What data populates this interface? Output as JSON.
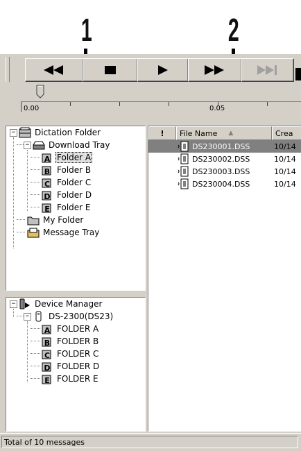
{
  "callouts": [
    {
      "label": "1"
    },
    {
      "label": "2"
    }
  ],
  "toolbar": {
    "buttons": [
      {
        "name": "rewind-button",
        "icon": "rewind-icon",
        "enabled": true
      },
      {
        "name": "stop-button",
        "icon": "stop-icon",
        "enabled": true
      },
      {
        "name": "play-button",
        "icon": "play-icon",
        "enabled": true
      },
      {
        "name": "fast-forward-button",
        "icon": "fast-forward-icon",
        "enabled": true
      },
      {
        "name": "skip-to-end-button",
        "icon": "skip-end-icon",
        "enabled": false
      }
    ]
  },
  "ruler": {
    "labels": [
      "0.00",
      "0.05"
    ]
  },
  "dictation_tree": {
    "root": "Dictation Folder",
    "download_tray": "Download Tray",
    "folders": [
      "Folder A",
      "Folder B",
      "Folder C",
      "Folder D",
      "Folder E"
    ],
    "folder_letters": [
      "A",
      "B",
      "C",
      "D",
      "E"
    ],
    "selected_folder": "Folder A",
    "my_folder": "My Folder",
    "message_tray": "Message Tray"
  },
  "device_tree": {
    "root": "Device Manager",
    "device": "DS-2300(DS23)",
    "folders": [
      "FOLDER A",
      "FOLDER B",
      "FOLDER C",
      "FOLDER D",
      "FOLDER E"
    ],
    "folder_letters": [
      "A",
      "B",
      "C",
      "D",
      "E"
    ]
  },
  "file_list": {
    "columns": [
      "!",
      "File Name",
      "Crea"
    ],
    "sort_indicator": "▲",
    "rows": [
      {
        "file_name": "DS230001.DSS",
        "created": "10/14"
      },
      {
        "file_name": "DS230002.DSS",
        "created": "10/14"
      },
      {
        "file_name": "DS230003.DSS",
        "created": "10/14"
      },
      {
        "file_name": "DS230004.DSS",
        "created": "10/14"
      }
    ],
    "selected_row": 0
  },
  "status": {
    "text": "Total of 10 messages"
  },
  "colors": {
    "face": "#d4d0c8",
    "selection": "#808080",
    "pane_bg": "#ffffff"
  }
}
